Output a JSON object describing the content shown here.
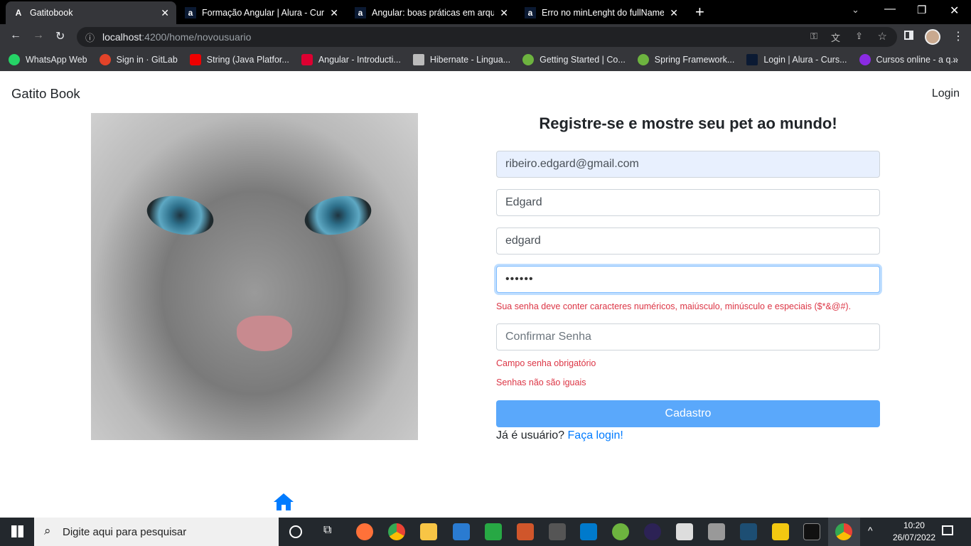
{
  "browser": {
    "tabs": [
      {
        "title": "Gatitobook",
        "icon": "angular-icon",
        "active": true
      },
      {
        "title": "Formação Angular | Alura - Curso",
        "icon": "alura-icon"
      },
      {
        "title": "Angular: boas práticas em arquite",
        "icon": "alura-icon"
      },
      {
        "title": "Erro no minLenght do fullName |",
        "icon": "alura-icon"
      }
    ],
    "url_host": "localhost",
    "url_path": ":4200/home/novousuario",
    "bookmarks": [
      {
        "label": "WhatsApp Web",
        "color": "#25d366"
      },
      {
        "label": "Sign in · GitLab",
        "color": "#e24329"
      },
      {
        "label": "String (Java Platfor...",
        "color": "#e00"
      },
      {
        "label": "Angular - Introducti...",
        "color": "#dd0031"
      },
      {
        "label": "Hibernate - Lingua...",
        "color": "#bbb"
      },
      {
        "label": "Getting Started | Co...",
        "color": "#6db33f"
      },
      {
        "label": "Spring Framework...",
        "color": "#6db33f"
      },
      {
        "label": "Login | Alura - Curs...",
        "color": "#0b1a33"
      },
      {
        "label": "Cursos online - a q...",
        "color": "#8a2be2"
      }
    ]
  },
  "page": {
    "brand": "Gatito Book",
    "login": "Login",
    "title": "Registre-se e mostre seu pet ao mundo!",
    "email": "ribeiro.edgard@gmail.com",
    "full_name": "Edgard",
    "username": "edgard",
    "password_masked": "••••••",
    "password_error": "Sua senha deve conter caracteres numéricos, maiúsculo, minúsculo e especiais ($*&@#).",
    "confirm_placeholder": "Confirmar Senha",
    "confirm_error_required": "Campo senha obrigatório",
    "confirm_error_mismatch": "Senhas não são iguais",
    "submit": "Cadastro",
    "already_user": "Já é usuário?",
    "login_link": "Faça login!",
    "accent": "#007bff",
    "error_color": "#dc3545"
  },
  "taskbar": {
    "search_placeholder": "Digite aqui para pesquisar",
    "time": "10:20",
    "date": "26/07/2022"
  }
}
